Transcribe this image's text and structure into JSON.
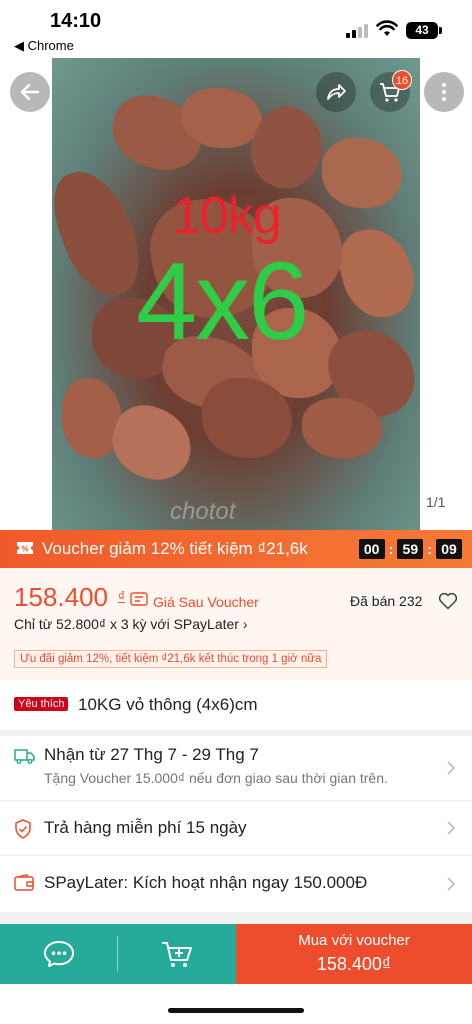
{
  "status_bar": {
    "time": "14:10",
    "back_app": "◀ Chrome",
    "battery": "43"
  },
  "hero": {
    "overlay_weight": "10kg",
    "overlay_size": "4x6",
    "image_counter": "1/1",
    "watermark": "chotot",
    "cart_count": "16"
  },
  "voucher_banner": {
    "text": "Voucher giảm 12% tiết kiệm ₫21,6k",
    "countdown": [
      "00",
      "59",
      "09"
    ]
  },
  "price": {
    "amount": "158.400",
    "currency": "₫",
    "after_voucher_label": "Giá Sau Voucher",
    "sold": "Đã bán 232",
    "installment": "Chỉ từ 52.800₫ x 3 kỳ với SPayLater ›",
    "promo_note": "Ưu đãi giảm 12%, tiết kiệm ₫21,6k kết thúc trong 1 giờ nữa"
  },
  "product": {
    "badge": "Yêu thích",
    "title": "10KG vỏ thông (4x6)cm"
  },
  "shipping": {
    "main": "Nhận từ 27 Thg 7 - 29 Thg 7",
    "sub": "Tặng Voucher 15.000₫ nếu đơn giao sau thời gian trên."
  },
  "returns": {
    "main": "Trả hàng miễn phí 15 ngày"
  },
  "spaylater": {
    "main": "SPayLater: Kích hoạt nhận ngay 150.000Đ"
  },
  "bottom_bar": {
    "buy_label": "Mua với voucher",
    "buy_price": "158.400₫"
  },
  "colors": {
    "brand": "#ee4d2d",
    "teal": "#26aa99",
    "promo_green": "#2ecc47",
    "promo_red": "#e8232e"
  }
}
